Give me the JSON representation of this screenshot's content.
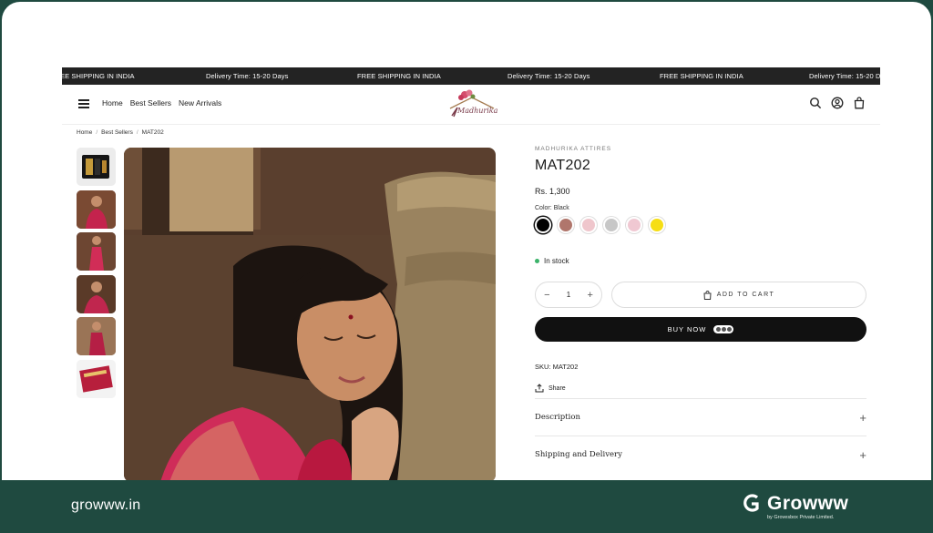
{
  "ticker": [
    "EE SHIPPING IN INDIA",
    "Delivery Time: 15-20 Days",
    "FREE SHIPPING IN INDIA",
    "Delivery Time: 15-20 Days",
    "FREE SHIPPING IN INDIA",
    "Delivery Time: 15-20 Da"
  ],
  "nav": {
    "links": [
      "Home",
      "Best Sellers",
      "New Arrivals"
    ],
    "logo_text": "Madhurika"
  },
  "breadcrumb": [
    "Home",
    "Best Sellers",
    "MAT202"
  ],
  "product": {
    "vendor": "MADHURIKA ATTIRES",
    "title": "MAT202",
    "price": "Rs. 1,300",
    "color_label": "Color: Black",
    "swatches": [
      "#000000",
      "#b0766c",
      "#efc6cc",
      "#c7c7c7",
      "#f0c8d2",
      "#f6de14"
    ],
    "stock": "In stock",
    "quantity": "1",
    "add_to_cart": "ADD TO CART",
    "buy_now": "BUY NOW",
    "sku": "SKU: MAT202",
    "share": "Share",
    "accordions": [
      "Description",
      "Shipping and Delivery"
    ]
  },
  "footer": {
    "url": "growww.in",
    "brand": "Growww",
    "brand_sub": "by Grovesbox Private Limited."
  },
  "colors": {
    "footer_bg": "#1f4a40",
    "ticker_bg": "#232323",
    "buy_bg": "#111111",
    "in_stock": "#3bb36a"
  }
}
